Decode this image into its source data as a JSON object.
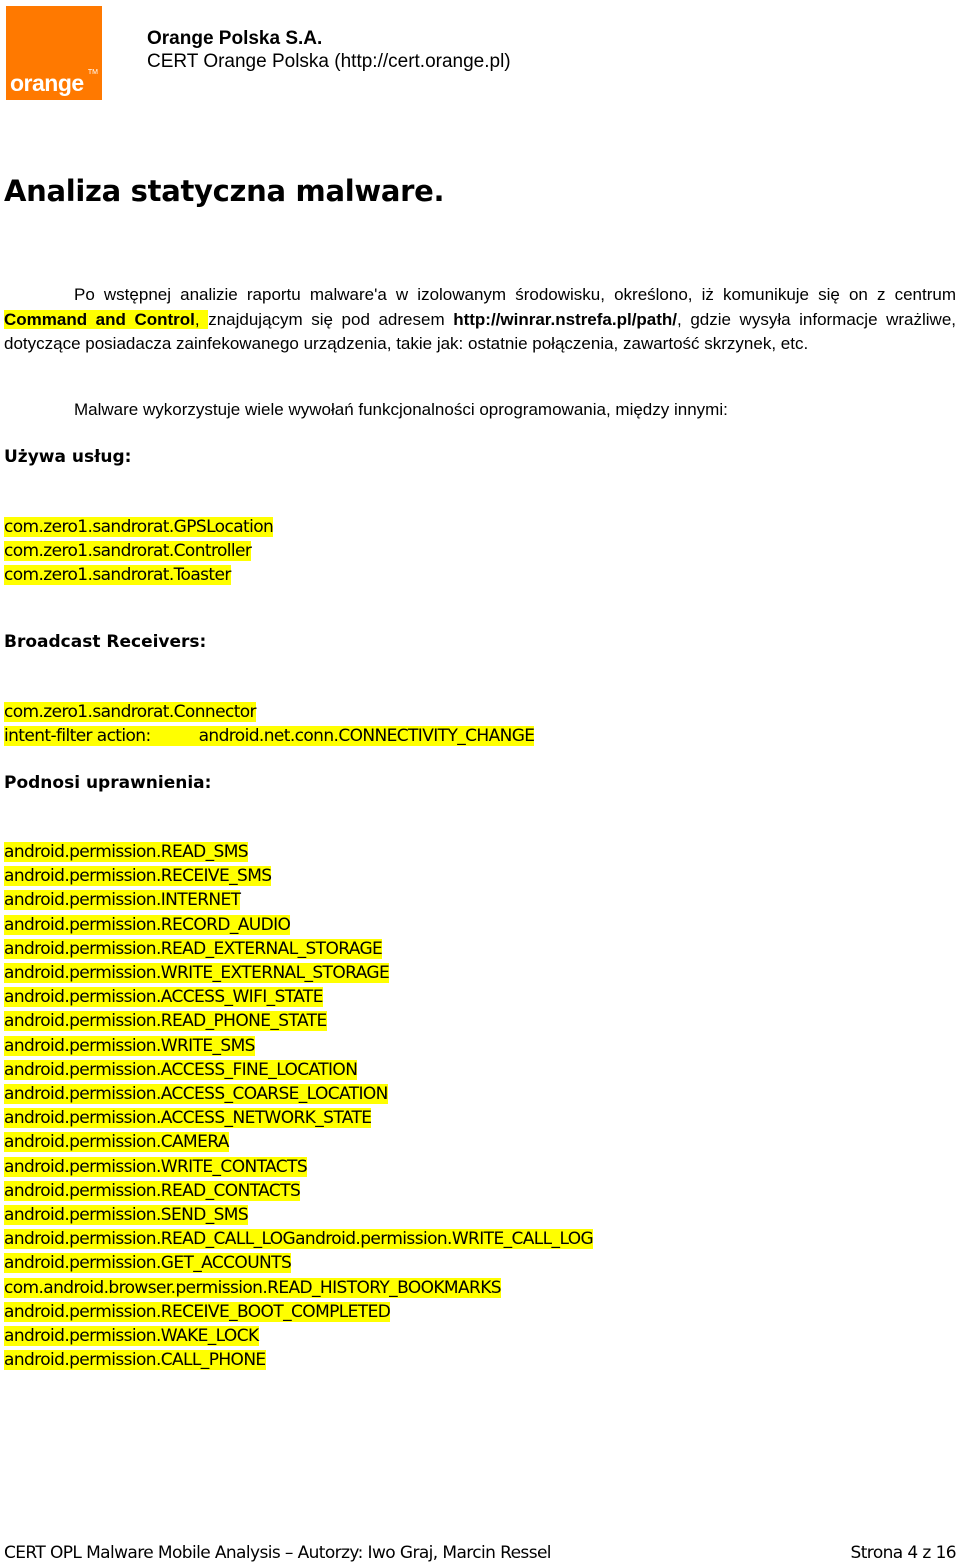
{
  "header": {
    "logo_text": "orange",
    "logo_tm": "TM",
    "brand_color": "#ff7900",
    "org_name": "Orange Polska S.A.",
    "org_sub": "CERT Orange Polska (http://cert.orange.pl)"
  },
  "title": "Analiza statyczna malware.",
  "intro": {
    "p1_before": "Po wstępnej analizie raportu malware'a w izolowanym środowisku, określono, iż komunikuje się on z centrum ",
    "p1_highlight": "Command and Control",
    "p1_highlight_tail": ", ",
    "p1_mid": "znajdującym się pod adresem ",
    "p1_url": "http://winrar.nstrefa.pl/path/",
    "p1_after": ", gdzie wysyła informacje wrażliwe, dotyczące posiadacza zainfekowanego urządzenia, takie jak: ostatnie połączenia, zawartość skrzynek, etc.",
    "p2": "Malware wykorzystuje wiele wywołań funkcjonalności oprogramowania, między innymi:"
  },
  "services": {
    "heading": "Używa usług:",
    "items": [
      "com.zero1.sandrorat.GPSLocation",
      "com.zero1.sandrorat.Controller",
      "com.zero1.sandrorat.Toaster"
    ]
  },
  "receivers": {
    "heading": "Broadcast Receivers:",
    "name": "com.zero1.sandrorat.Connector",
    "filter_label": "intent-filter action:",
    "filter_value": "android.net.conn.CONNECTIVITY_CHANGE"
  },
  "permissions": {
    "heading": "Podnosi uprawnienia:",
    "items": [
      "android.permission.READ_SMS",
      "android.permission.RECEIVE_SMS",
      "android.permission.INTERNET",
      "android.permission.RECORD_AUDIO",
      "android.permission.READ_EXTERNAL_STORAGE",
      "android.permission.WRITE_EXTERNAL_STORAGE",
      "android.permission.ACCESS_WIFI_STATE",
      "android.permission.READ_PHONE_STATE",
      "android.permission.WRITE_SMS",
      "android.permission.ACCESS_FINE_LOCATION",
      "android.permission.ACCESS_COARSE_LOCATION",
      "android.permission.ACCESS_NETWORK_STATE",
      "android.permission.CAMERA",
      "android.permission.WRITE_CONTACTS",
      "android.permission.READ_CONTACTS",
      "android.permission.SEND_SMS",
      "android.permission.READ_CALL_LOGandroid.permission.WRITE_CALL_LOG",
      "android.permission.GET_ACCOUNTS",
      "com.android.browser.permission.READ_HISTORY_BOOKMARKS",
      "android.permission.RECEIVE_BOOT_COMPLETED",
      "android.permission.WAKE_LOCK",
      "android.permission.CALL_PHONE"
    ]
  },
  "footer": {
    "left": "CERT OPL  Malware Mobile Analysis – Autorzy: Iwo Graj, Marcin Ressel",
    "right": "Strona 4 z 16"
  },
  "highlight_color": "#ffff00"
}
